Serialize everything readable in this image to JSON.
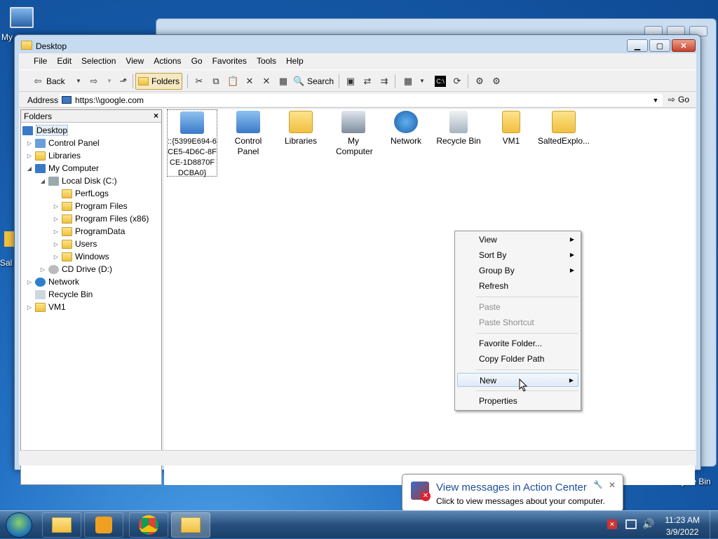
{
  "desktop": {
    "icon_top_left": "My",
    "icon_mid_left": "Sal",
    "icon_recycle": "Recycle Bin"
  },
  "window": {
    "title": "Desktop"
  },
  "menu": [
    "File",
    "Edit",
    "Selection",
    "View",
    "Actions",
    "Go",
    "Favorites",
    "Tools",
    "Help"
  ],
  "toolbar": {
    "back": "Back",
    "folders": "Folders",
    "search": "Search"
  },
  "address": {
    "label": "Address",
    "value": "https:\\\\google.com",
    "go": "Go"
  },
  "folders_panel": {
    "title": "Folders",
    "close": "×"
  },
  "tree": [
    "Desktop",
    "Control Panel",
    "Libraries",
    "My Computer",
    "Local Disk (C:)",
    "PerfLogs",
    "Program Files",
    "Program Files (x86)",
    "ProgramData",
    "Users",
    "Windows",
    "CD Drive (D:)",
    "Network",
    "Recycle Bin",
    "VM1"
  ],
  "items": [
    "::{5399E694-6CE5-4D6C-8FCE-1D8870FDCBA0}",
    "Control Panel",
    "Libraries",
    "My Computer",
    "Network",
    "Recycle Bin",
    "VM1",
    "SaltedExplo..."
  ],
  "context_menu": {
    "view": "View",
    "sort_by": "Sort By",
    "group_by": "Group By",
    "refresh": "Refresh",
    "paste": "Paste",
    "paste_shortcut": "Paste Shortcut",
    "favorite_folder": "Favorite Folder...",
    "copy_folder_path": "Copy Folder Path",
    "new": "New",
    "properties": "Properties"
  },
  "balloon": {
    "title": "View messages in Action Center",
    "text": "Click to view messages about your computer."
  },
  "clock": {
    "time": "11:23 AM",
    "date": "3/9/2022"
  }
}
